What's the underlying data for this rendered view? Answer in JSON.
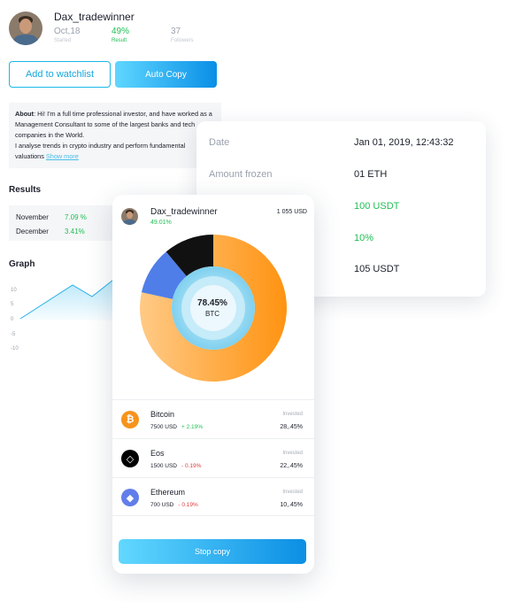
{
  "profile": {
    "name": "Dax_tradewinner",
    "stats": [
      {
        "value": "Oct,18",
        "label": "Started"
      },
      {
        "value": "49%",
        "label": "Result"
      },
      {
        "value": "37",
        "label": "Followers"
      }
    ],
    "watchlist_label": "Add to watchlist",
    "auto_copy_label": "Auto Copy",
    "about_label": "About",
    "about_text": ": Hi! I'm a full time professional investor, and have worked as a Management Consultant to some of the largest banks and tech companies in the World.",
    "about_text2": "I analyse trends in crypto industry and perform fundamental valuations",
    "show_more": "Show more",
    "results_title": "Results",
    "results": [
      {
        "month": "November",
        "value": "7.09 %"
      },
      {
        "month": "December",
        "value": "3.41%"
      }
    ],
    "graph_title": "Graph",
    "graph_yticks": [
      "10",
      "5",
      "0",
      "-5",
      "-10"
    ]
  },
  "details": [
    {
      "label": "Date",
      "value": "Jan 01, 2019, 12:43:32",
      "color": "#1b1f2a"
    },
    {
      "label": "Amount frozen",
      "value": "01 ETH",
      "color": "#1b1f2a"
    },
    {
      "label": "",
      "value": "100 USDT",
      "color": "#1fbf52"
    },
    {
      "label": "",
      "value": "10%",
      "color": "#1fbf52"
    },
    {
      "label": "",
      "value": "105 USDT",
      "color": "#1b1f2a"
    }
  ],
  "portfolio": {
    "name": "Dax_tradewinner",
    "result": "49.01%",
    "total": "1 055 USD",
    "center_value": "78.45%",
    "center_coin": "BTC",
    "allocation": [
      {
        "coin": "BTC",
        "percent": 78.45,
        "color": "#ff9d2b"
      },
      {
        "coin": "ETH",
        "percent": 10.45,
        "color": "#4f7ee8"
      },
      {
        "coin": "EOS",
        "percent": 11.1,
        "color": "#111111"
      }
    ],
    "coins": [
      {
        "name": "Bitcoin",
        "amount": "7500 USD",
        "change": "+ 2.19%",
        "trend": "pos",
        "invested_label": "Invested",
        "invested": "28,.45%",
        "icon": "bitcoin-icon",
        "icon_char": "₿",
        "color": "#f7931a"
      },
      {
        "name": "Eos",
        "amount": "1500 USD",
        "change": "- 0.19%",
        "trend": "neg",
        "invested_label": "Invested",
        "invested": "22,.45%",
        "icon": "eos-icon",
        "icon_char": "◇",
        "color": "#000000"
      },
      {
        "name": "Ethereum",
        "amount": "700 USD",
        "change": "- 0.19%",
        "trend": "neg",
        "invested_label": "Invested",
        "invested": "10,.45%",
        "icon": "ethereum-icon",
        "icon_char": "◆",
        "color": "#627eea"
      }
    ],
    "stop_label": "Stop copy"
  }
}
